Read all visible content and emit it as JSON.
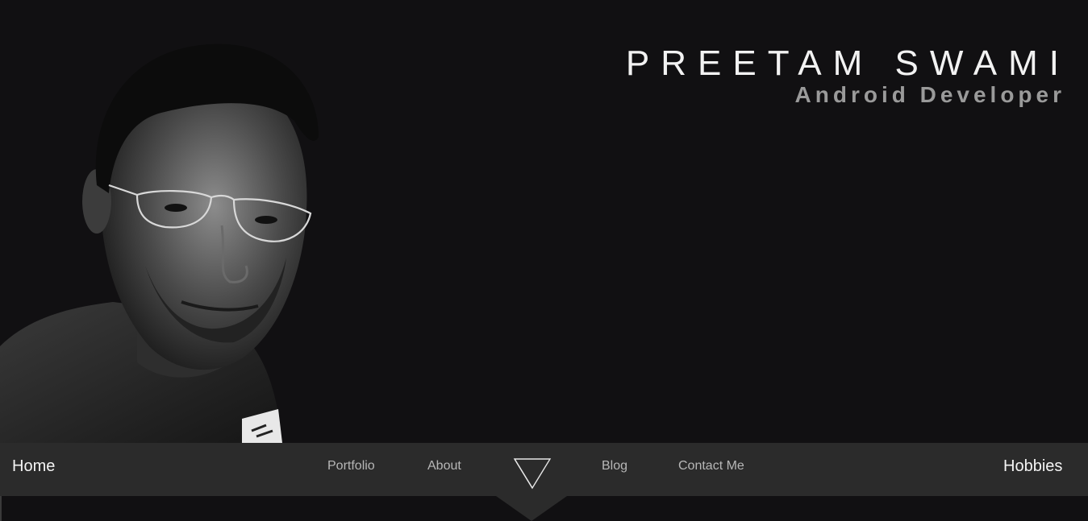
{
  "header": {
    "name": "PREETAM SWAMI",
    "role": "Android Developer"
  },
  "nav": {
    "home": "Home",
    "portfolio": "Portfolio",
    "about": "About",
    "blog": "Blog",
    "contact": "Contact Me",
    "hobbies": "Hobbies",
    "logo_icon": "triangle-down-logo-icon"
  },
  "colors": {
    "background": "#111012",
    "navbar": "#2b2b2b",
    "title": "#f2f2f2",
    "subtitle": "#9a9a9a",
    "nav_text": "#b7b7b7"
  }
}
